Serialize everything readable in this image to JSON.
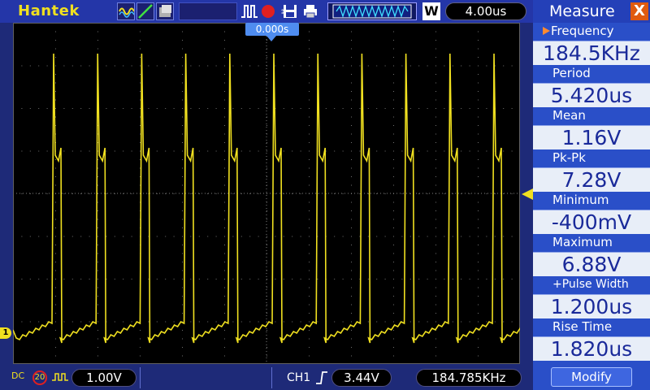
{
  "toolbar": {
    "brand": "Hantek",
    "mode_w": "W",
    "timebase": "4.00us",
    "icons": [
      "sine-wave-icon",
      "ramp-icon",
      "persistence-icon",
      "pulse-icon",
      "record-icon",
      "scissors-icon",
      "save-icon",
      "print-icon",
      "waveform-overview-icon"
    ]
  },
  "screen": {
    "trigger_position": "0.000s",
    "channel_marker": "1"
  },
  "status": {
    "coupling": "DC",
    "bandwidth": "20",
    "ch1_scale": "1.00V",
    "trigger_source": "CH1",
    "trigger_level": "3.44V",
    "trigger_frequency": "184.785KHz"
  },
  "measure": {
    "title": "Measure",
    "close": "X",
    "items": [
      {
        "label": "Frequency",
        "value": "184.5KHz"
      },
      {
        "label": "Period",
        "value": "5.420us"
      },
      {
        "label": "Mean",
        "value": "1.16V"
      },
      {
        "label": "Pk-Pk",
        "value": "7.28V"
      },
      {
        "label": "Minimum",
        "value": "-400mV"
      },
      {
        "label": "Maximum",
        "value": "6.88V"
      },
      {
        "label": "+Pulse Width",
        "value": "1.200us"
      },
      {
        "label": "Rise Time",
        "value": "1.820us"
      }
    ],
    "modify": "Modify"
  },
  "colors": {
    "trace": "#f0e020",
    "background": "#1e2a78",
    "panel": "#2a4fc8",
    "accent_orange": "#e05a10",
    "trigger_marker": "#4f8df0"
  }
}
